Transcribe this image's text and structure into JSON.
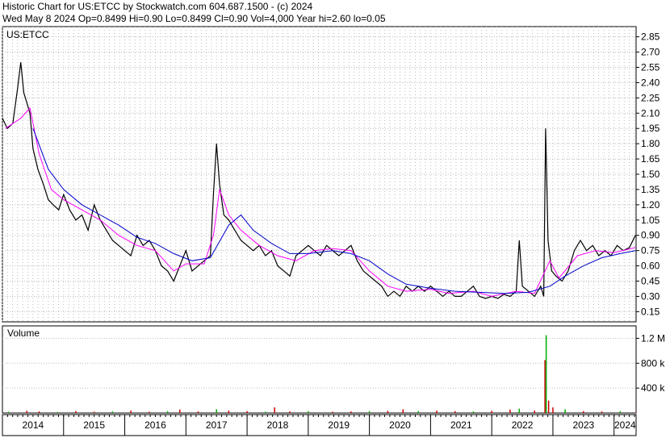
{
  "header": {
    "line1": "Historic Chart for US:ETCC by Stockwatch.com 604.687.1500 - (c) 2024",
    "line2": "Wed May  8 2024   Op=0.8499  Hi=0.90  Lo=0.8499  Cl=0.90  Vol=4,000  Year hi=2.60  lo=0.05"
  },
  "colors": {
    "price": "#000000",
    "ma_short": "#ff00ff",
    "ma_long": "#0000cc",
    "down_close": "#cc0000",
    "vol_up": "#00aa00",
    "vol_down": "#cc0000",
    "grid": "#bbbbbb",
    "panel_bg": "#ffffff"
  },
  "chart_data": [
    {
      "type": "line",
      "title": "US:ETCC",
      "xlabel": "",
      "ylabel": "",
      "ylim": [
        0.05,
        2.95
      ],
      "grid": true,
      "y_ticks": [
        "2.85",
        "2.70",
        "2.55",
        "2.40",
        "2.25",
        "2.10",
        "1.95",
        "1.80",
        "1.65",
        "1.50",
        "1.35",
        "1.20",
        "1.05",
        "0.90",
        "0.75",
        "0.60",
        "0.45",
        "0.30",
        "0.15"
      ],
      "x_ticks": [
        "2014",
        "2015",
        "2016",
        "2017",
        "2018",
        "2019",
        "2020",
        "2021",
        "2022",
        "2023",
        "2024"
      ],
      "x_range": [
        2014.0,
        2024.36
      ],
      "series": [
        {
          "role": "price",
          "points": [
            [
              2014.0,
              2.05
            ],
            [
              2014.08,
              1.95
            ],
            [
              2014.17,
              2.0
            ],
            [
              2014.25,
              2.35
            ],
            [
              2014.3,
              2.6
            ],
            [
              2014.35,
              2.3
            ],
            [
              2014.45,
              2.1
            ],
            [
              2014.5,
              1.75
            ],
            [
              2014.58,
              1.55
            ],
            [
              2014.67,
              1.4
            ],
            [
              2014.75,
              1.25
            ],
            [
              2014.83,
              1.2
            ],
            [
              2014.92,
              1.15
            ],
            [
              2015.0,
              1.3
            ],
            [
              2015.1,
              1.15
            ],
            [
              2015.2,
              1.05
            ],
            [
              2015.3,
              1.1
            ],
            [
              2015.4,
              0.95
            ],
            [
              2015.5,
              1.2
            ],
            [
              2015.6,
              1.05
            ],
            [
              2015.7,
              0.95
            ],
            [
              2015.8,
              0.85
            ],
            [
              2015.9,
              0.8
            ],
            [
              2016.0,
              0.75
            ],
            [
              2016.1,
              0.7
            ],
            [
              2016.2,
              0.9
            ],
            [
              2016.3,
              0.8
            ],
            [
              2016.4,
              0.85
            ],
            [
              2016.5,
              0.75
            ],
            [
              2016.6,
              0.6
            ],
            [
              2016.7,
              0.55
            ],
            [
              2016.8,
              0.45
            ],
            [
              2016.9,
              0.6
            ],
            [
              2017.0,
              0.75
            ],
            [
              2017.1,
              0.55
            ],
            [
              2017.2,
              0.6
            ],
            [
              2017.3,
              0.65
            ],
            [
              2017.4,
              0.7
            ],
            [
              2017.45,
              1.3
            ],
            [
              2017.5,
              1.8
            ],
            [
              2017.55,
              1.4
            ],
            [
              2017.62,
              1.1
            ],
            [
              2017.7,
              1.05
            ],
            [
              2017.8,
              0.95
            ],
            [
              2017.9,
              0.85
            ],
            [
              2018.0,
              0.8
            ],
            [
              2018.1,
              0.75
            ],
            [
              2018.2,
              0.8
            ],
            [
              2018.3,
              0.7
            ],
            [
              2018.4,
              0.75
            ],
            [
              2018.5,
              0.6
            ],
            [
              2018.6,
              0.55
            ],
            [
              2018.7,
              0.5
            ],
            [
              2018.8,
              0.7
            ],
            [
              2018.9,
              0.75
            ],
            [
              2019.0,
              0.8
            ],
            [
              2019.1,
              0.75
            ],
            [
              2019.2,
              0.7
            ],
            [
              2019.3,
              0.8
            ],
            [
              2019.4,
              0.75
            ],
            [
              2019.5,
              0.7
            ],
            [
              2019.6,
              0.75
            ],
            [
              2019.7,
              0.8
            ],
            [
              2019.8,
              0.65
            ],
            [
              2019.9,
              0.55
            ],
            [
              2020.0,
              0.5
            ],
            [
              2020.1,
              0.45
            ],
            [
              2020.2,
              0.4
            ],
            [
              2020.3,
              0.3
            ],
            [
              2020.4,
              0.35
            ],
            [
              2020.5,
              0.3
            ],
            [
              2020.6,
              0.4
            ],
            [
              2020.7,
              0.35
            ],
            [
              2020.8,
              0.4
            ],
            [
              2020.9,
              0.35
            ],
            [
              2021.0,
              0.4
            ],
            [
              2021.1,
              0.35
            ],
            [
              2021.2,
              0.3
            ],
            [
              2021.3,
              0.35
            ],
            [
              2021.4,
              0.3
            ],
            [
              2021.5,
              0.3
            ],
            [
              2021.6,
              0.35
            ],
            [
              2021.7,
              0.4
            ],
            [
              2021.8,
              0.3
            ],
            [
              2021.9,
              0.28
            ],
            [
              2022.0,
              0.3
            ],
            [
              2022.1,
              0.28
            ],
            [
              2022.2,
              0.32
            ],
            [
              2022.3,
              0.3
            ],
            [
              2022.4,
              0.35
            ],
            [
              2022.45,
              0.85
            ],
            [
              2022.5,
              0.4
            ],
            [
              2022.6,
              0.35
            ],
            [
              2022.7,
              0.3
            ],
            [
              2022.8,
              0.4
            ],
            [
              2022.85,
              0.3
            ],
            [
              2022.88,
              1.95
            ],
            [
              2022.92,
              0.85
            ],
            [
              2022.98,
              0.55
            ],
            [
              2023.05,
              0.5
            ],
            [
              2023.15,
              0.45
            ],
            [
              2023.25,
              0.55
            ],
            [
              2023.35,
              0.75
            ],
            [
              2023.45,
              0.85
            ],
            [
              2023.55,
              0.75
            ],
            [
              2023.65,
              0.8
            ],
            [
              2023.75,
              0.7
            ],
            [
              2023.85,
              0.75
            ],
            [
              2023.95,
              0.7
            ],
            [
              2024.05,
              0.8
            ],
            [
              2024.15,
              0.75
            ],
            [
              2024.25,
              0.78
            ],
            [
              2024.35,
              0.9
            ]
          ]
        },
        {
          "role": "ma_short",
          "points": [
            [
              2014.05,
              1.95
            ],
            [
              2014.3,
              2.05
            ],
            [
              2014.45,
              2.15
            ],
            [
              2014.6,
              1.7
            ],
            [
              2014.8,
              1.35
            ],
            [
              2015.0,
              1.25
            ],
            [
              2015.3,
              1.15
            ],
            [
              2015.6,
              1.05
            ],
            [
              2015.9,
              0.9
            ],
            [
              2016.2,
              0.8
            ],
            [
              2016.5,
              0.75
            ],
            [
              2016.8,
              0.55
            ],
            [
              2017.0,
              0.62
            ],
            [
              2017.3,
              0.62
            ],
            [
              2017.45,
              0.9
            ],
            [
              2017.55,
              1.35
            ],
            [
              2017.7,
              1.1
            ],
            [
              2017.9,
              0.95
            ],
            [
              2018.2,
              0.8
            ],
            [
              2018.5,
              0.7
            ],
            [
              2018.8,
              0.65
            ],
            [
              2019.1,
              0.75
            ],
            [
              2019.4,
              0.77
            ],
            [
              2019.7,
              0.75
            ],
            [
              2020.0,
              0.55
            ],
            [
              2020.3,
              0.4
            ],
            [
              2020.6,
              0.35
            ],
            [
              2021.0,
              0.37
            ],
            [
              2021.3,
              0.33
            ],
            [
              2021.7,
              0.35
            ],
            [
              2022.0,
              0.3
            ],
            [
              2022.4,
              0.35
            ],
            [
              2022.7,
              0.33
            ],
            [
              2022.95,
              0.65
            ],
            [
              2023.1,
              0.48
            ],
            [
              2023.4,
              0.7
            ],
            [
              2023.7,
              0.75
            ],
            [
              2024.0,
              0.73
            ],
            [
              2024.35,
              0.78
            ]
          ]
        },
        {
          "role": "ma_long",
          "points": [
            [
              2014.5,
              1.95
            ],
            [
              2014.75,
              1.55
            ],
            [
              2015.0,
              1.35
            ],
            [
              2015.3,
              1.2
            ],
            [
              2015.6,
              1.1
            ],
            [
              2015.9,
              1.0
            ],
            [
              2016.2,
              0.88
            ],
            [
              2016.5,
              0.82
            ],
            [
              2016.8,
              0.72
            ],
            [
              2017.1,
              0.65
            ],
            [
              2017.4,
              0.68
            ],
            [
              2017.7,
              1.0
            ],
            [
              2017.9,
              1.1
            ],
            [
              2018.1,
              0.95
            ],
            [
              2018.4,
              0.82
            ],
            [
              2018.7,
              0.72
            ],
            [
              2019.0,
              0.72
            ],
            [
              2019.4,
              0.75
            ],
            [
              2019.7,
              0.72
            ],
            [
              2020.0,
              0.65
            ],
            [
              2020.3,
              0.52
            ],
            [
              2020.6,
              0.42
            ],
            [
              2021.0,
              0.38
            ],
            [
              2021.4,
              0.35
            ],
            [
              2021.8,
              0.34
            ],
            [
              2022.2,
              0.33
            ],
            [
              2022.6,
              0.34
            ],
            [
              2022.95,
              0.4
            ],
            [
              2023.2,
              0.5
            ],
            [
              2023.5,
              0.6
            ],
            [
              2023.8,
              0.68
            ],
            [
              2024.1,
              0.72
            ],
            [
              2024.35,
              0.75
            ]
          ]
        }
      ]
    },
    {
      "type": "bar",
      "title": "Volume",
      "xlabel": "",
      "ylabel": "",
      "ylim": [
        0,
        1400000
      ],
      "y_ticks": [
        "1.2 M",
        "800 k",
        "400 k"
      ],
      "y_tick_values": [
        1200000,
        800000,
        400000
      ],
      "bars": [
        [
          2014.1,
          20000
        ],
        [
          2014.4,
          35000
        ],
        [
          2014.6,
          25000
        ],
        [
          2014.9,
          15000
        ],
        [
          2015.2,
          30000
        ],
        [
          2015.5,
          20000
        ],
        [
          2015.8,
          25000
        ],
        [
          2016.1,
          40000
        ],
        [
          2016.4,
          20000
        ],
        [
          2016.7,
          30000
        ],
        [
          2016.9,
          55000
        ],
        [
          2017.2,
          25000
        ],
        [
          2017.5,
          60000
        ],
        [
          2017.7,
          40000
        ],
        [
          2018.0,
          30000
        ],
        [
          2018.3,
          20000
        ],
        [
          2018.45,
          90000
        ],
        [
          2018.7,
          25000
        ],
        [
          2019.0,
          30000
        ],
        [
          2019.4,
          20000
        ],
        [
          2019.7,
          25000
        ],
        [
          2020.0,
          30000
        ],
        [
          2020.3,
          35000
        ],
        [
          2020.55,
          60000
        ],
        [
          2020.8,
          30000
        ],
        [
          2021.1,
          40000
        ],
        [
          2021.4,
          30000
        ],
        [
          2021.7,
          25000
        ],
        [
          2022.0,
          35000
        ],
        [
          2022.3,
          55000
        ],
        [
          2022.45,
          70000
        ],
        [
          2022.7,
          40000
        ],
        [
          2022.87,
          850000
        ],
        [
          2022.89,
          1250000
        ],
        [
          2022.93,
          200000
        ],
        [
          2023.0,
          90000
        ],
        [
          2023.2,
          60000
        ],
        [
          2023.5,
          30000
        ],
        [
          2023.8,
          25000
        ],
        [
          2024.1,
          30000
        ],
        [
          2024.35,
          4000
        ]
      ]
    }
  ]
}
